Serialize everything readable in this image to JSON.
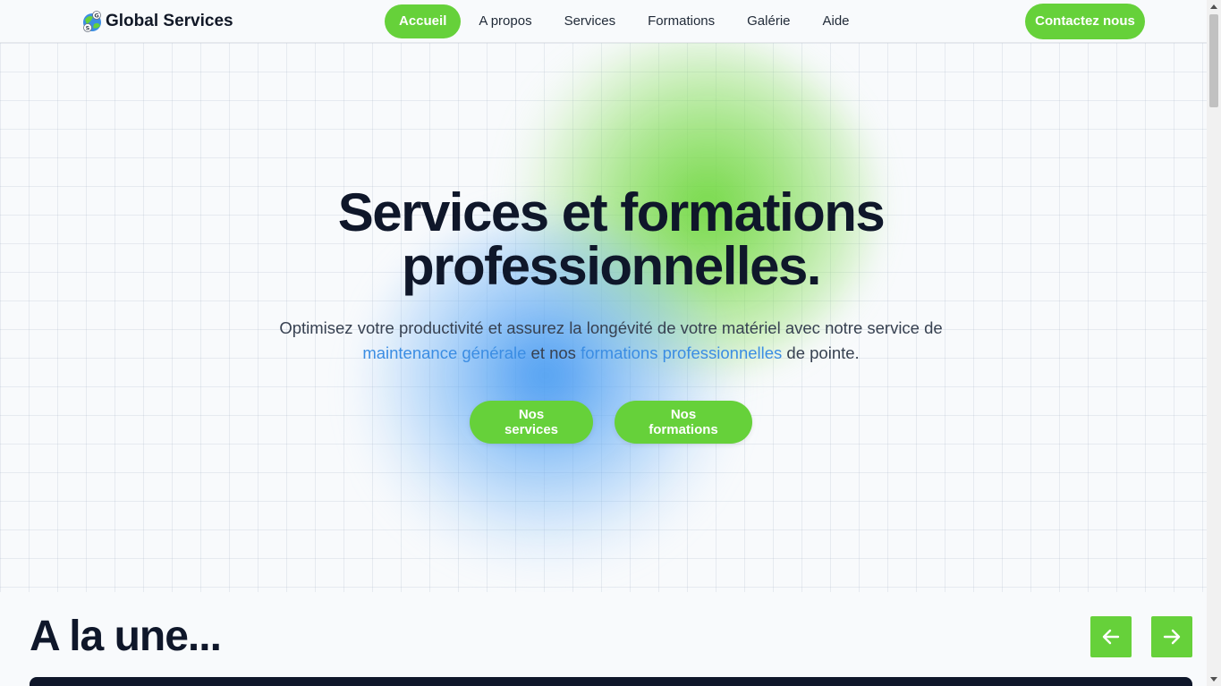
{
  "header": {
    "brand": "Global Services",
    "logo_icon": "gs-globe-logo-icon",
    "nav": [
      {
        "label": "Accueil",
        "active": true
      },
      {
        "label": "A propos",
        "active": false
      },
      {
        "label": "Services",
        "active": false
      },
      {
        "label": "Formations",
        "active": false
      },
      {
        "label": "Galérie",
        "active": false
      },
      {
        "label": "Aide",
        "active": false
      }
    ],
    "contact_label": "Contactez nous"
  },
  "hero": {
    "title_line1": "Services et formations",
    "title_line2": "professionnelles.",
    "subtitle_part1": "Optimisez votre productivité et assurez la longévité de votre matériel avec notre service de ",
    "subtitle_link1": "maintenance générale",
    "subtitle_part2": " et nos ",
    "subtitle_link2": "formations professionnelles",
    "subtitle_part3": " de pointe.",
    "btn_services": "Nos services",
    "btn_formations": "Nos formations"
  },
  "section": {
    "title": "A la une...",
    "prev_icon": "arrow-left-icon",
    "next_icon": "arrow-right-icon"
  },
  "colors": {
    "accent": "#66d13a",
    "link": "#3b8de3",
    "text": "#0f172a",
    "background": "#f8fafc"
  }
}
